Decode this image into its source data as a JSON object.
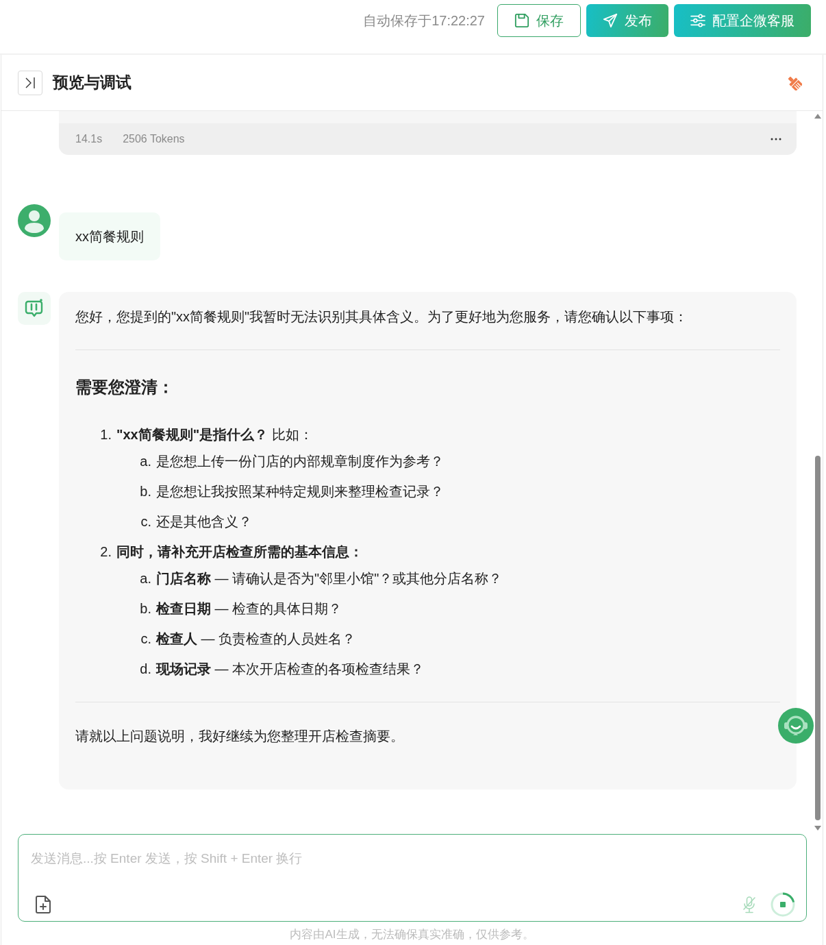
{
  "toolbar": {
    "autosave": "自动保存于17:22:27",
    "buttons": [
      {
        "label": "保存",
        "kind": "save"
      },
      {
        "label": "发布",
        "kind": "publish"
      },
      {
        "label": "配置企微客服",
        "kind": "configure"
      }
    ]
  },
  "panel": {
    "title": "预览与调试"
  },
  "messages": [
    {
      "kind": "stats",
      "duration": "14.1s",
      "tokens": "2506 Tokens"
    },
    {
      "kind": "user",
      "text": "xx简餐规则"
    },
    {
      "kind": "assistant",
      "blocks": [
        {
          "kind": "paragraph",
          "text": "您好，您提到的\"xx简餐规则\"我暂时无法识别其具体含义。为了更好地为您服务，请您确认以下事项："
        },
        {
          "kind": "divider"
        },
        {
          "kind": "heading",
          "text": "需要您澄清："
        },
        {
          "kind": "list",
          "items": [
            {
              "marker": "1.",
              "text": "**\"xx简餐规则\"是指什么？** 比如：",
              "children": [
                {
                  "marker": "a.",
                  "text": "是您想上传一份门店的内部规章制度作为参考？"
                },
                {
                  "marker": "b.",
                  "text": "是您想让我按照某种特定规则来整理检查记录？"
                },
                {
                  "marker": "c.",
                  "text": "还是其他含义？"
                }
              ]
            },
            {
              "marker": "2.",
              "text": "**同时，请补充开店检查所需的基本信息：**",
              "children": [
                {
                  "marker": "a.",
                  "text": "**门店名称** — 请确认是否为\"邻里小馆\"？或其他分店名称？"
                },
                {
                  "marker": "b.",
                  "text": "**检查日期** — 检查的具体日期？"
                },
                {
                  "marker": "c.",
                  "text": "**检查人** — 负责检查的人员姓名？"
                },
                {
                  "marker": "d.",
                  "text": "**现场记录** — 本次开店检查的各项检查结果？"
                }
              ]
            }
          ]
        },
        {
          "kind": "divider"
        },
        {
          "kind": "paragraph",
          "text": "请就以上问题说明，我好继续为您整理开店检查摘要。"
        }
      ]
    }
  ],
  "composer": {
    "placeholder": "发送消息...按 Enter 发送，按 Shift + Enter 换行"
  },
  "disclaimer": "内容由AI生成，无法确保真实准确，仅供参考。"
}
